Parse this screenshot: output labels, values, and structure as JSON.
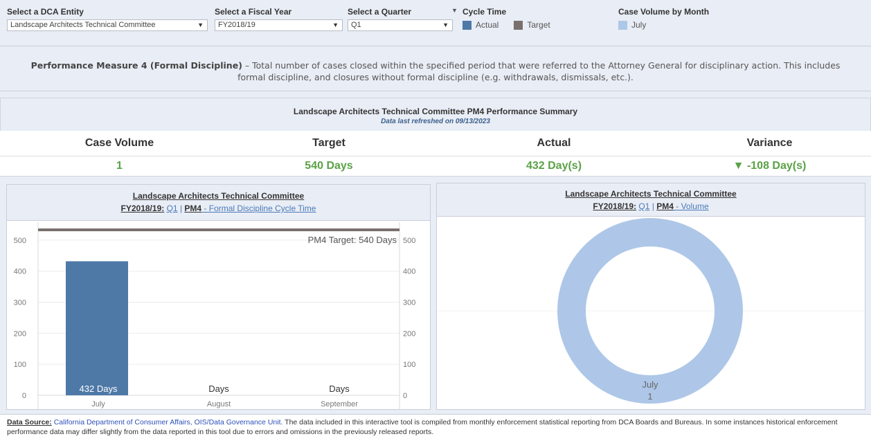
{
  "filters": {
    "entity": {
      "label": "Select a DCA Entity",
      "value": "Landscape Architects Technical Committee"
    },
    "fiscal_year": {
      "label": "Select a Fiscal Year",
      "value": "FY2018/19"
    },
    "quarter": {
      "label": "Select a Quarter",
      "value": "Q1"
    },
    "cycle_time": {
      "label": "Cycle Time",
      "actual": "Actual",
      "target": "Target",
      "actual_color": "#4e79a7",
      "target_color": "#79706e"
    },
    "case_volume": {
      "label": "Case Volume by Month",
      "month": "July",
      "color": "#aec7e8"
    }
  },
  "measure": {
    "title": "Performance Measure 4 (Formal Discipline)",
    "line1": " – Total number of cases closed within the specified period that were referred to the Attorney General for disciplinary action. This includes",
    "line2": "formal discipline, and closures without formal discipline (e.g. withdrawals, dismissals, etc.)."
  },
  "summary": {
    "title": "Landscape Architects Technical Committee PM4 Performance Summary",
    "refreshed": "Data last refreshed on 09/13/2023",
    "labels": {
      "volume": "Case Volume",
      "target": "Target",
      "actual": "Actual",
      "variance": "Variance"
    },
    "values": {
      "volume": "1",
      "target": "540 Days",
      "actual": "432 Day(s)",
      "variance": "▼ -108 Day(s)"
    }
  },
  "cycle_panel": {
    "title": "Landscape Architects Technical Committee",
    "fy": "FY2018/19:",
    "quarter": "Q1",
    "sep": " | ",
    "pm": "PM4",
    "desc": " - Formal Discipline Cycle Time"
  },
  "volume_panel": {
    "title": "Landscape Architects Technical Committee",
    "fy": "FY2018/19:",
    "quarter": "Q1",
    "sep": " | ",
    "pm": "PM4",
    "desc": " - Volume"
  },
  "chart_data": [
    {
      "type": "bar",
      "categories": [
        "July",
        "August",
        "September"
      ],
      "values": [
        432,
        0,
        0
      ],
      "bar_labels": [
        "432 Days",
        "Days",
        "Days"
      ],
      "ylim": [
        0,
        540
      ],
      "yticks": [
        0,
        100,
        200,
        300,
        400,
        500
      ],
      "reference_line": {
        "value": 540,
        "label": "PM4 Target: 540 Days",
        "color": "#79706e"
      },
      "bar_color": "#4e79a7",
      "dual_axis": true
    },
    {
      "type": "pie",
      "donut": true,
      "slices": [
        {
          "label": "July",
          "value": 1,
          "color": "#aec7e8"
        }
      ]
    }
  ],
  "footer": {
    "label": "Data Source:",
    "source": "California Department of Consumer Affairs, OIS/Data Governance Unit.",
    "text": "  The data included in this interactive tool is compiled from monthly enforcement statistical reporting from DCA Boards and Bureaus.  In some instances historical enforcement performance data may differ slightly from the data reported in this tool due to errors and omissions in the previously released reports."
  }
}
